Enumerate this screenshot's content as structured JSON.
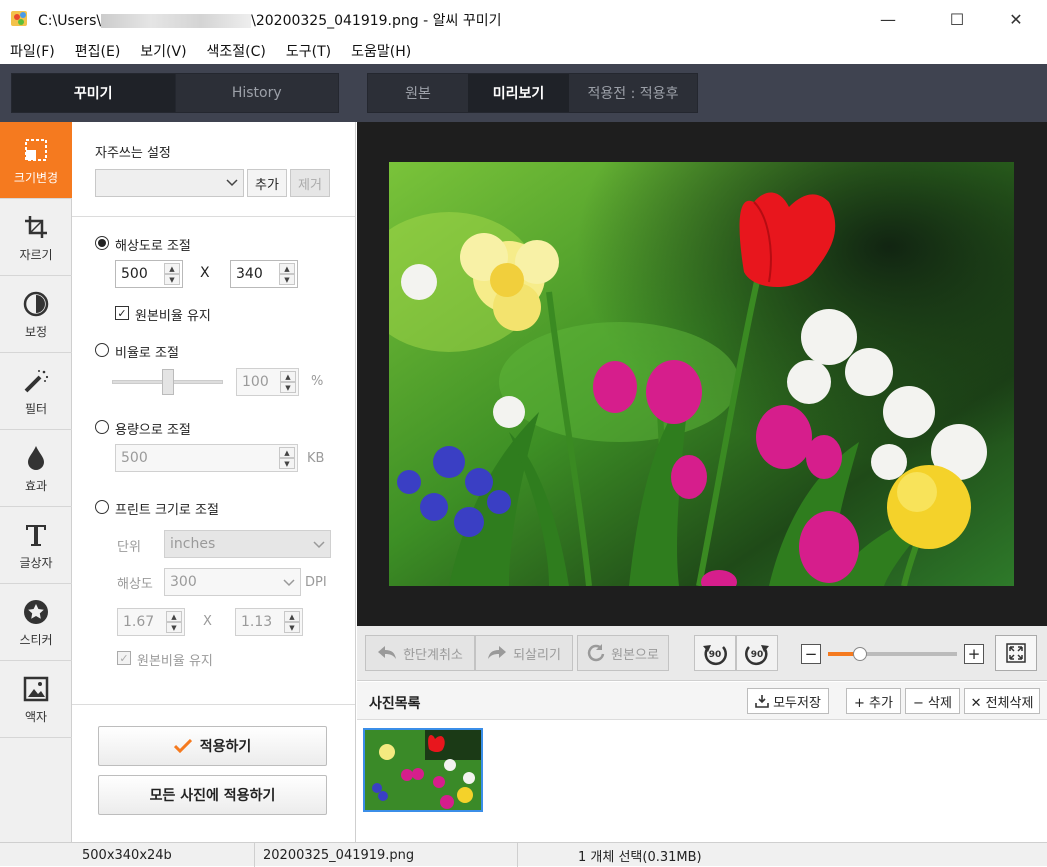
{
  "window": {
    "title_prefix": "C:\\Users\\",
    "title_suffix": "\\20200325_041919.png - 알씨 꾸미기",
    "minimize": "—",
    "maximize": "☐",
    "close": "✕"
  },
  "menu": [
    "파일(F)",
    "편집(E)",
    "보기(V)",
    "색조절(C)",
    "도구(T)",
    "도움말(H)"
  ],
  "left_tabs": [
    "꾸미기",
    "History"
  ],
  "view_tabs": [
    "원본",
    "미리보기",
    "적용전 : 적용후"
  ],
  "sidebar": [
    "크기변경",
    "자르기",
    "보정",
    "필터",
    "효과",
    "글상자",
    "스티커",
    "액자"
  ],
  "panel": {
    "favorites_label": "자주쓰는 설정",
    "add": "추가",
    "remove": "제거",
    "by_resolution": "해상도로 조절",
    "width": "500",
    "height": "340",
    "x": "X",
    "keep_ratio": "원본비율 유지",
    "by_ratio": "비율로 조절",
    "ratio_value": "100",
    "percent": "%",
    "by_size": "용량으로 조절",
    "size_value": "500",
    "kb": "KB",
    "by_print": "프린트 크기로 조절",
    "unit_label": "단위",
    "unit_value": "inches",
    "res_label": "해상도",
    "res_value": "300",
    "dpi": "DPI",
    "print_w": "1.67",
    "print_h": "1.13",
    "keep_ratio2": "원본비율 유지",
    "apply": "적용하기",
    "apply_all": "모든 사진에 적용하기",
    "ratio_slider_level": 0.5
  },
  "toolbar": {
    "undo": "한단계취소",
    "redo": "되살리기",
    "revert": "원본으로",
    "rot_left": "90",
    "rot_right": "90",
    "zoom_minus": "−",
    "zoom_plus": "+",
    "zoom_level": 0.25
  },
  "photo_list": {
    "title": "사진목록",
    "save_all": "모두저장",
    "add": "+ 추가",
    "delete": "− 삭제",
    "delete_all": "✕ 전체삭제"
  },
  "status": {
    "dims": "500x340x24b",
    "file": "20200325_041919.png",
    "selection": "1 개체 선택(0.31MB)"
  },
  "colors": {
    "accent": "#f57a1f",
    "dark_band": "#3f4350",
    "thumb_border": "#3b8ee8"
  }
}
